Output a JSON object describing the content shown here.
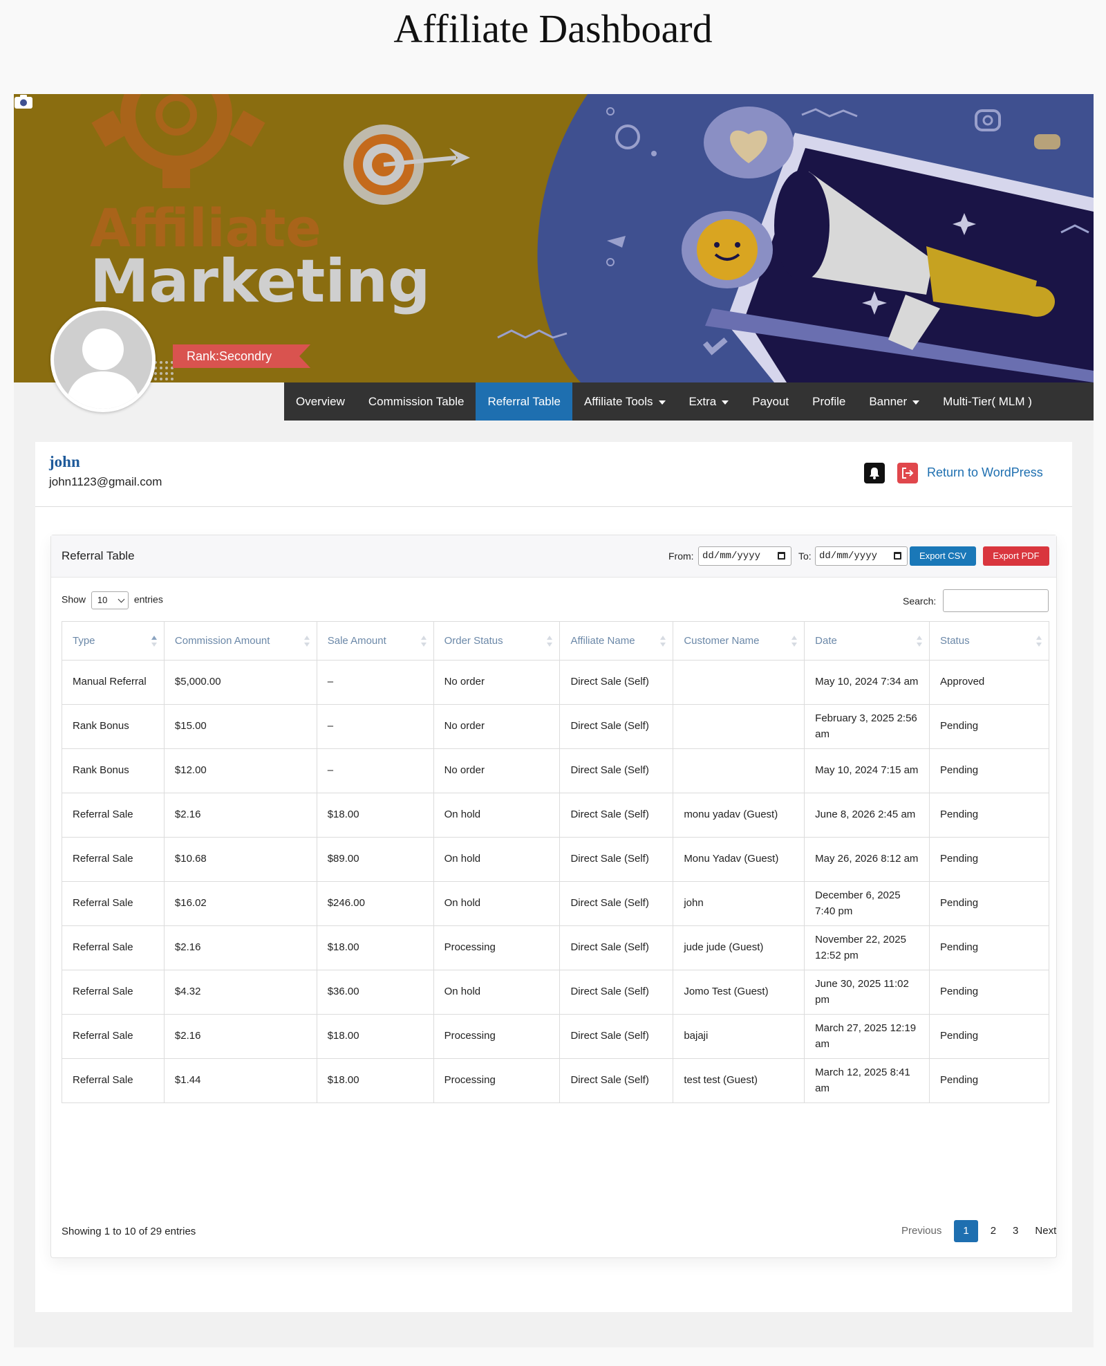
{
  "page": {
    "title": "Affiliate Dashboard"
  },
  "banner": {
    "headline_top": "Affiliate",
    "headline_bottom": "Marketing"
  },
  "profile": {
    "rank": "Rank:Secondry",
    "name": "john",
    "email": "john1123@gmail.com",
    "return_link": "Return to WordPress"
  },
  "nav": {
    "items": [
      {
        "label": "Overview"
      },
      {
        "label": "Commission Table"
      },
      {
        "label": "Referral Table"
      },
      {
        "label": "Affiliate Tools"
      },
      {
        "label": "Extra"
      },
      {
        "label": "Payout"
      },
      {
        "label": "Profile"
      },
      {
        "label": "Banner"
      },
      {
        "label": "Multi-Tier( MLM )"
      }
    ],
    "active": "Referral Table"
  },
  "panel": {
    "title": "Referral Table",
    "from_label": "From:",
    "to_label": "To:",
    "from_value": "dd/mm/yyyy",
    "to_value": "dd/mm/yyyy",
    "export_csv": "Export CSV",
    "export_pdf": "Export PDF",
    "show_label": "Show",
    "entries_label": "entries",
    "page_length": "10",
    "search_label": "Search:",
    "search_value": ""
  },
  "table": {
    "headers": [
      "Type",
      "Commission Amount",
      "Sale Amount",
      "Order Status",
      "Affiliate Name",
      "Customer Name",
      "Date",
      "Status"
    ],
    "rows": [
      [
        "Manual Referral",
        "$5,000.00",
        "–",
        "No order",
        "Direct Sale (Self)",
        "",
        "May 10, 2024 7:34 am",
        "Approved"
      ],
      [
        "Rank Bonus",
        "$15.00",
        "–",
        "No order",
        "Direct Sale (Self)",
        "",
        "February 3, 2025 2:56 am",
        "Pending"
      ],
      [
        "Rank Bonus",
        "$12.00",
        "–",
        "No order",
        "Direct Sale (Self)",
        "",
        "May 10, 2024 7:15 am",
        "Pending"
      ],
      [
        "Referral Sale",
        "$2.16",
        "$18.00",
        "On hold",
        "Direct Sale (Self)",
        "monu yadav (Guest)",
        "June 8, 2026 2:45 am",
        "Pending"
      ],
      [
        "Referral Sale",
        "$10.68",
        "$89.00",
        "On hold",
        "Direct Sale (Self)",
        "Monu Yadav (Guest)",
        "May 26, 2026 8:12 am",
        "Pending"
      ],
      [
        "Referral Sale",
        "$16.02",
        "$246.00",
        "On hold",
        "Direct Sale (Self)",
        "john",
        "December 6, 2025 7:40 pm",
        "Pending"
      ],
      [
        "Referral Sale",
        "$2.16",
        "$18.00",
        "Processing",
        "Direct Sale (Self)",
        "jude jude (Guest)",
        "November 22, 2025 12:52 pm",
        "Pending"
      ],
      [
        "Referral Sale",
        "$4.32",
        "$36.00",
        "On hold",
        "Direct Sale (Self)",
        "Jomo Test (Guest)",
        "June 30, 2025 11:02 pm",
        "Pending"
      ],
      [
        "Referral Sale",
        "$2.16",
        "$18.00",
        "Processing",
        "Direct Sale (Self)",
        "bajaji",
        "March 27, 2025 12:19 am",
        "Pending"
      ],
      [
        "Referral Sale",
        "$1.44",
        "$18.00",
        "Processing",
        "Direct Sale (Self)",
        "test test (Guest)",
        "March 12, 2025 8:41 am",
        "Pending"
      ]
    ]
  },
  "footer": {
    "info": "Showing 1 to 10 of 29 entries",
    "previous": "Previous",
    "pages": [
      "1",
      "2",
      "3"
    ],
    "current_page": "1",
    "next": "Next"
  },
  "colors": {
    "nav_bg": "#333333",
    "accent": "#1e6fb0",
    "danger": "#d9363e",
    "rank_bg": "#d9534f",
    "banner_gold": "#8a6d10",
    "banner_blue": "#3f5090"
  },
  "icons": {
    "camera": "camera-icon",
    "bell": "bell-icon",
    "logout": "logout-icon",
    "avatar": "avatar-placeholder-icon",
    "calendar": "calendar-icon",
    "sort": "sort-icon"
  }
}
